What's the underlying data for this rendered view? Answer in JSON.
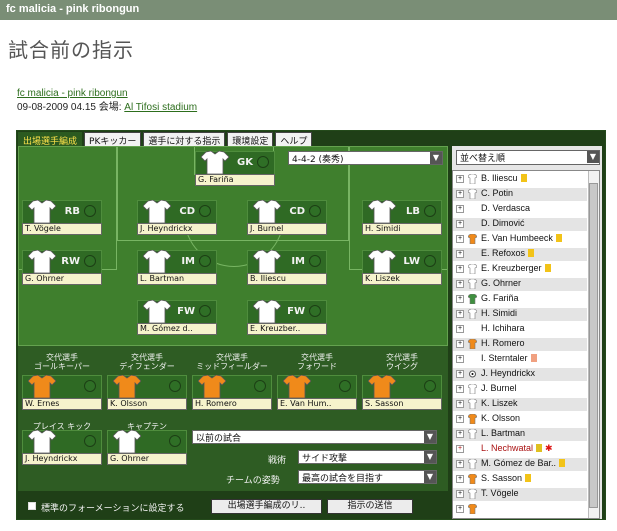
{
  "window_title": "fc malicia - pink ribongun",
  "page_heading": "試合前の指示",
  "match": {
    "team_link": "fc malicia - pink ribongun",
    "date_venue_prefix": "09-08-2009 04.15 会場:",
    "stadium_link": "Al Tifosi stadium"
  },
  "tabs": [
    "出場選手編成",
    "PKキッカー",
    "選手に対する指示",
    "環境設定",
    "ヘルプ"
  ],
  "formation_select": "4-4-2 (奏秀)",
  "pitch_players": [
    {
      "pos": "GK",
      "name": "G. Fariña",
      "shirt": "white"
    },
    {
      "pos": "RB",
      "name": "T. Vögele",
      "shirt": "white"
    },
    {
      "pos": "CD",
      "name": "J. Heyndrickx",
      "shirt": "white"
    },
    {
      "pos": "CD",
      "name": "J. Burnel",
      "shirt": "white"
    },
    {
      "pos": "LB",
      "name": "H. Simidi",
      "shirt": "white"
    },
    {
      "pos": "RW",
      "name": "G. Ohrner",
      "shirt": "white"
    },
    {
      "pos": "IM",
      "name": "L. Bartman",
      "shirt": "white"
    },
    {
      "pos": "IM",
      "name": "B. Iliescu",
      "shirt": "white"
    },
    {
      "pos": "LW",
      "name": "K. Liszek",
      "shirt": "white"
    },
    {
      "pos": "FW",
      "name": "M. Gómez d..",
      "shirt": "white"
    },
    {
      "pos": "FW",
      "name": "E. Kreuzber..",
      "shirt": "white"
    }
  ],
  "substitutes": [
    {
      "label_line1": "交代選手",
      "label_line2": "ゴールキーパー",
      "name": "W. Ernes"
    },
    {
      "label_line1": "交代選手",
      "label_line2": "ディフェンダー",
      "name": "K. Olsson"
    },
    {
      "label_line1": "交代選手",
      "label_line2": "ミッドフィールダー",
      "name": "H. Romero"
    },
    {
      "label_line1": "交代選手",
      "label_line2": "フォワード",
      "name": "E. Van Hum.."
    },
    {
      "label_line1": "交代選手",
      "label_line2": "ウイング",
      "name": "S. Sasson"
    }
  ],
  "set_pieces": {
    "label": "プレイス キック",
    "name": "J. Heyndrickx"
  },
  "captain": {
    "label": "キャプテン",
    "name": "G. Ohrner"
  },
  "previous_match_select": "以前の試合",
  "tactics_label": "戦術",
  "tactics_select": "サイド攻撃",
  "attitude_label": "チームの姿勢",
  "attitude_select": "最高の試合を目指す",
  "default_formation_checkbox": "標準のフォーメーションに設定する",
  "lineup_button": "出場選手編成のリ..",
  "send_button": "指示の送信",
  "sort_select": "並べ替え順",
  "roster": [
    {
      "name": "B. Iliescu",
      "badge": "yellow",
      "shirt": "white",
      "prefix": "+"
    },
    {
      "name": "C. Potin",
      "badge": "",
      "shirt": "white",
      "prefix": "+"
    },
    {
      "name": "D. Verdasca",
      "badge": "",
      "shirt": "none",
      "prefix": "+"
    },
    {
      "name": "D. Dimović",
      "badge": "",
      "shirt": "none",
      "prefix": "+"
    },
    {
      "name": "E. Van Humbeeck",
      "badge": "yellow",
      "shirt": "orange",
      "prefix": "+"
    },
    {
      "name": "E. Refoxos",
      "badge": "yellow",
      "shirt": "none",
      "prefix": "+"
    },
    {
      "name": "E. Kreuzberger",
      "badge": "yellow",
      "shirt": "white",
      "prefix": "+"
    },
    {
      "name": "G. Ohrner",
      "badge": "",
      "shirt": "white",
      "prefix": "+"
    },
    {
      "name": "G. Fariña",
      "badge": "",
      "shirt": "green",
      "prefix": "+"
    },
    {
      "name": "H. Simidi",
      "badge": "",
      "shirt": "white",
      "prefix": "+"
    },
    {
      "name": "H. Ichihara",
      "badge": "",
      "shirt": "none",
      "prefix": "+"
    },
    {
      "name": "H. Romero",
      "badge": "",
      "shirt": "orange",
      "prefix": "+"
    },
    {
      "name": "I. Sterntaler",
      "badge": "orange",
      "shirt": "none",
      "prefix": "+"
    },
    {
      "name": "J. Heyndrickx",
      "badge": "",
      "shirt": "dot",
      "prefix": "+"
    },
    {
      "name": "J. Burnel",
      "badge": "",
      "shirt": "white",
      "prefix": "+"
    },
    {
      "name": "K. Liszek",
      "badge": "",
      "shirt": "white",
      "prefix": "+"
    },
    {
      "name": "K. Olsson",
      "badge": "",
      "shirt": "orange",
      "prefix": "+"
    },
    {
      "name": "L. Bartman",
      "badge": "",
      "shirt": "white",
      "prefix": "+"
    },
    {
      "name": "L. Nechwatal",
      "badge": "red-star",
      "shirt": "none",
      "prefix": "+",
      "red": true
    },
    {
      "name": "M. Gómez de Bar..",
      "badge": "yellow",
      "shirt": "white",
      "prefix": "+"
    },
    {
      "name": "S. Sasson",
      "badge": "yellow",
      "shirt": "orange",
      "prefix": "+"
    },
    {
      "name": "T. Vögele",
      "badge": "",
      "shirt": "white",
      "prefix": "+"
    },
    {
      "name": "",
      "badge": "",
      "shirt": "orange",
      "prefix": "+"
    }
  ],
  "colors": {
    "accent_yellow": "#fde24a",
    "pitch_green": "#3f7f2d",
    "dark_green": "#1f3f17",
    "shirt_orange": "#f08a1a"
  }
}
